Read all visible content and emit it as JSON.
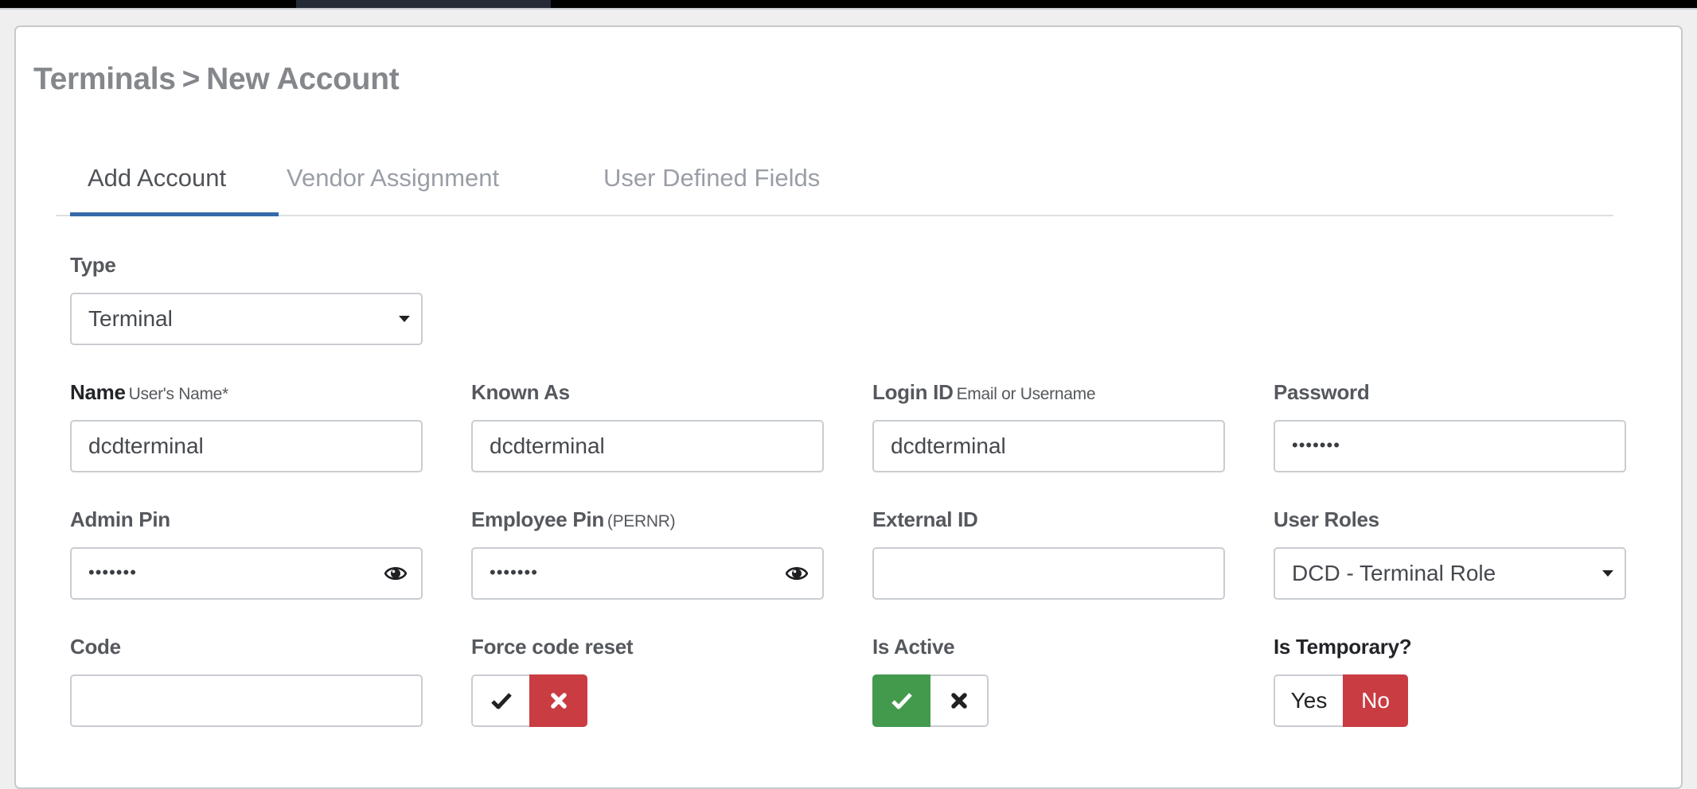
{
  "breadcrumb": {
    "parent": "Terminals",
    "separator": ">",
    "current": "New Account"
  },
  "tabs": [
    {
      "label": "Add Account",
      "active": true
    },
    {
      "label": "Vendor Assignment",
      "active": false
    },
    {
      "label": "User Defined Fields",
      "active": false
    }
  ],
  "form": {
    "type": {
      "label": "Type",
      "value": "Terminal"
    },
    "name": {
      "label": "Name",
      "hint": "User's Name*",
      "value": "dcdterminal"
    },
    "known_as": {
      "label": "Known As",
      "value": "dcdterminal"
    },
    "login_id": {
      "label": "Login ID",
      "hint": "Email or Username",
      "value": "dcdterminal"
    },
    "password": {
      "label": "Password",
      "value": "•••••••"
    },
    "admin_pin": {
      "label": "Admin Pin",
      "value": "•••••••",
      "icon": "eye-icon"
    },
    "employee_pin": {
      "label": "Employee Pin",
      "hint": "(PERNR)",
      "value": "•••••••",
      "icon": "eye-icon"
    },
    "external_id": {
      "label": "External ID",
      "value": ""
    },
    "user_roles": {
      "label": "User Roles",
      "value": "DCD - Terminal Role"
    },
    "code": {
      "label": "Code",
      "value": ""
    },
    "force_code_reset": {
      "label": "Force code reset",
      "state": "off",
      "on_icon": "check-icon",
      "off_icon": "x-icon"
    },
    "is_active": {
      "label": "Is Active",
      "state": "on",
      "on_icon": "check-icon",
      "off_icon": "x-icon"
    },
    "is_temporary": {
      "label": "Is Temporary?",
      "state": "No",
      "yes_label": "Yes",
      "no_label": "No"
    }
  },
  "colors": {
    "accent": "#336aa7",
    "danger": "#c93c42",
    "success": "#43994c"
  }
}
